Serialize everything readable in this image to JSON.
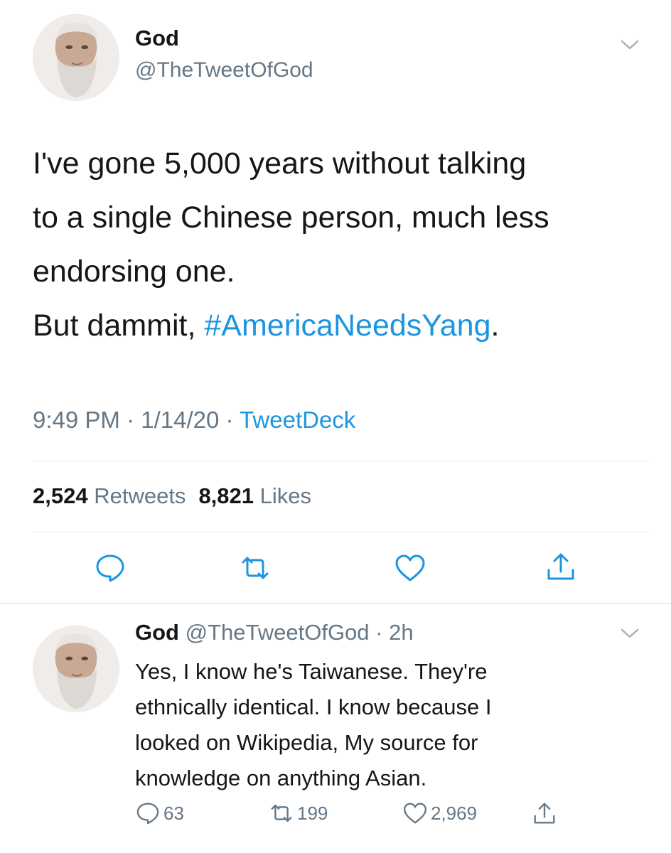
{
  "main_tweet": {
    "author_name": "God",
    "author_handle": "@TheTweetOfGod",
    "text_lines": [
      "I've gone 5,000 years without talking",
      "to a single Chinese person, much less",
      "endorsing one."
    ],
    "last_line_prefix": "But dammit, ",
    "hashtag": "#AmericaNeedsYang",
    "last_line_suffix": ".",
    "time": "9:49 PM",
    "separator": " · ",
    "date": "1/14/20",
    "source": "TweetDeck",
    "retweets_count": "2,524",
    "retweets_label": "Retweets",
    "likes_count": "8,821",
    "likes_label": "Likes",
    "actions": [
      "reply-icon",
      "retweet-icon",
      "like-icon",
      "share-icon"
    ]
  },
  "reply_tweet": {
    "author_name": "God",
    "author_handle": "@TheTweetOfGod",
    "separator": " · ",
    "age": "2h",
    "text_lines": [
      "Yes, I know he's Taiwanese. They're",
      "ethnically identical. I know because I",
      "looked on Wikipedia, My source for",
      "knowledge on anything Asian."
    ],
    "reply_count": "63",
    "retweet_count": "199",
    "like_count": "2,969"
  },
  "colors": {
    "text": "#14171a",
    "secondary": "#657786",
    "link": "#1b95e0",
    "divider": "#e1e8ed"
  }
}
